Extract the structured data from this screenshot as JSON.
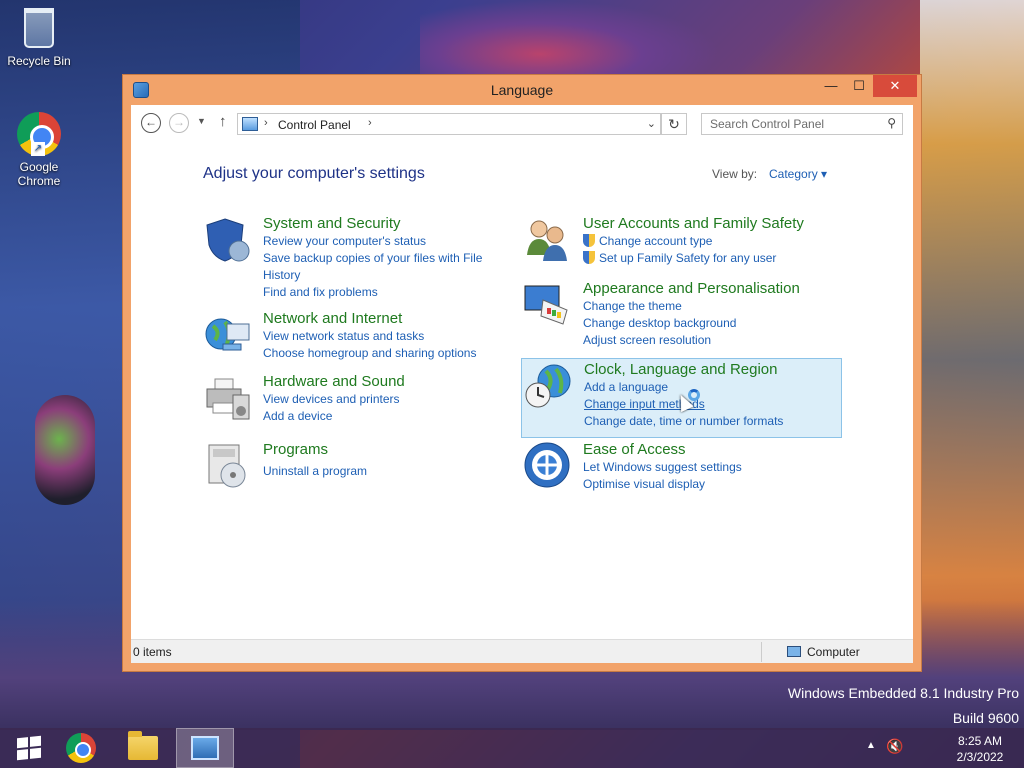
{
  "desktop": {
    "icons": [
      {
        "label": "Recycle Bin",
        "icon": "recycle-bin-icon"
      },
      {
        "label": "Google Chrome",
        "icon": "chrome-icon"
      }
    ],
    "watermark_line1": "Windows Embedded 8.1 Industry Pro",
    "watermark_line2": "Build 9600"
  },
  "window": {
    "title": "Language",
    "close_glyph": "✕",
    "max_glyph": "☐",
    "min_glyph": "—",
    "address": {
      "breadcrumb": "Control Panel",
      "separator": "›"
    },
    "search_placeholder": "Search Control Panel",
    "heading": "Adjust your computer's settings",
    "view_by_label": "View by:",
    "view_by_value": "Category ▾",
    "categories": [
      {
        "title": "System and Security",
        "icon": "shield-icon",
        "links": [
          "Review your computer's status",
          "Save backup copies of your files with File History",
          "Find and fix problems"
        ]
      },
      {
        "title": "Network and Internet",
        "icon": "network-globe-icon",
        "links": [
          "View network status and tasks",
          "Choose homegroup and sharing options"
        ]
      },
      {
        "title": "Hardware and Sound",
        "icon": "printer-icon",
        "links": [
          "View devices and printers",
          "Add a device"
        ]
      },
      {
        "title": "Programs",
        "icon": "programs-icon",
        "links": [
          "Uninstall a program"
        ]
      },
      {
        "title": "User Accounts and Family Safety",
        "icon": "users-icon",
        "links": [
          "Change account type",
          "Set up Family Safety for any user"
        ]
      },
      {
        "title": "Appearance and Personalisation",
        "icon": "monitor-palette-icon",
        "links": [
          "Change the theme",
          "Change desktop background",
          "Adjust screen resolution"
        ]
      },
      {
        "title": "Clock, Language and Region",
        "icon": "clock-globe-icon",
        "links": [
          "Add a language",
          "Change input methods",
          "Change date, time or number formats"
        ]
      },
      {
        "title": "Ease of Access",
        "icon": "ease-of-access-icon",
        "links": [
          "Let Windows suggest settings",
          "Optimise visual display"
        ]
      }
    ],
    "status": {
      "items": "0 items",
      "location": "Computer"
    }
  },
  "taskbar": {
    "clock_time": "8:25 AM",
    "clock_date": "2/3/2022"
  }
}
